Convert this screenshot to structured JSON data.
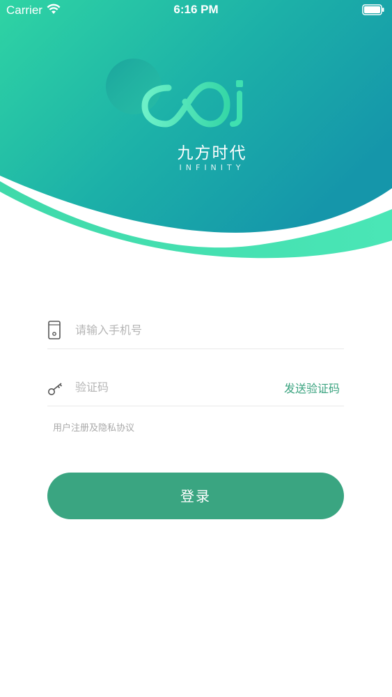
{
  "status_bar": {
    "carrier": "Carrier",
    "time": "6:16 PM"
  },
  "brand": {
    "name": "九方时代",
    "subtitle": "INFINITY"
  },
  "form": {
    "phone_placeholder": "请输入手机号",
    "code_placeholder": "验证码",
    "send_code_label": "发送验证码",
    "agreement_label": "用户注册及隐私协议",
    "login_label": "登录"
  },
  "colors": {
    "header_gradient_start": "#2fd0a2",
    "header_gradient_end": "#1596a9",
    "wave_accent": "#45e0b0",
    "primary_button": "#3aa581",
    "send_code_text": "#3aa37f"
  },
  "icons": {
    "phone_field": "phone-icon",
    "code_field": "key-icon",
    "wifi": "wifi-icon",
    "battery": "battery-icon"
  }
}
